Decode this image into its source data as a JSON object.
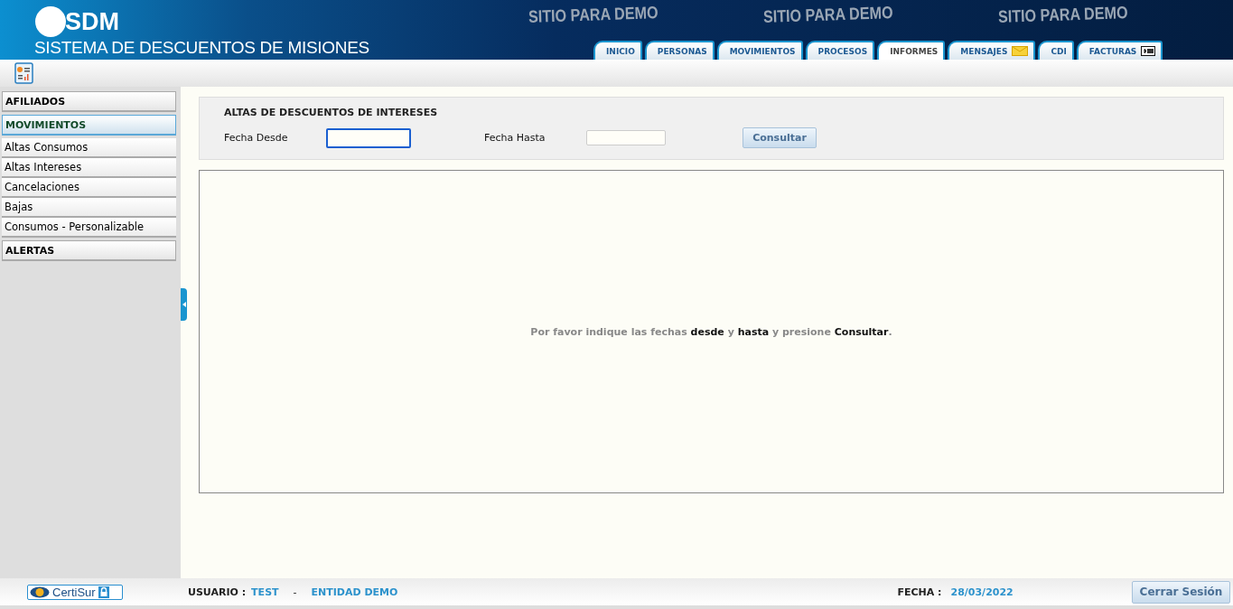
{
  "header": {
    "logo": "SDM",
    "title": "SISTEMA DE DESCUENTOS DE MISIONES",
    "demo_labels": [
      "SITIO PARA DEMO",
      "SITIO PARA DEMO",
      "SITIO PARA DEMO"
    ]
  },
  "tabs": [
    {
      "label": "INICIO",
      "selected": false,
      "kind": "plain"
    },
    {
      "label": "PERSONAS",
      "selected": false,
      "kind": "plain"
    },
    {
      "label": "MOVIMIENTOS",
      "selected": false,
      "kind": "plain"
    },
    {
      "label": "PROCESOS",
      "selected": false,
      "kind": "plain"
    },
    {
      "label": "INFORMES",
      "selected": true,
      "kind": "plain"
    },
    {
      "label": "MENSAJES",
      "selected": false,
      "kind": "envelope"
    },
    {
      "label": "CDI",
      "selected": false,
      "kind": "plain"
    },
    {
      "label": "FACTURAS",
      "selected": false,
      "kind": "bill"
    }
  ],
  "sidebar": {
    "sections": [
      {
        "label": "AFILIADOS",
        "selected": false
      },
      {
        "label": "MOVIMIENTOS",
        "selected": true,
        "children": [
          {
            "label": "Altas Consumos"
          },
          {
            "label": "Altas Intereses"
          },
          {
            "label": "Cancelaciones"
          },
          {
            "label": "Bajas"
          },
          {
            "label": "Consumos - Personalizable"
          }
        ]
      },
      {
        "label": "ALERTAS",
        "selected": false
      }
    ]
  },
  "form": {
    "title": "ALTAS DE DESCUENTOS DE INTERESES",
    "fields": [
      {
        "label": "Fecha Desde",
        "focused": true
      },
      {
        "label": "Fecha Hasta",
        "focused": false
      }
    ],
    "button": "Consultar"
  },
  "results": {
    "message": "Por favor indique las fechas **desde** y **hasta** y presione **Consultar**."
  },
  "status_bar": {
    "badge": "CertiSur",
    "user_label": "USUARIO :",
    "user": "TEST",
    "separator": "-",
    "entity": "ENTIDAD DEMO",
    "date_label": "FECHA :",
    "date": "28/03/2022",
    "logout": "Cerrar Sesión"
  }
}
